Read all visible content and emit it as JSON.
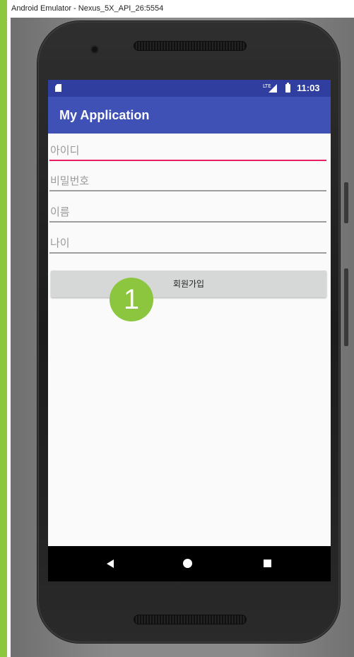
{
  "window": {
    "title": "Android Emulator - Nexus_5X_API_26:5554"
  },
  "status_bar": {
    "time": "11:03",
    "signal_label": "LTE"
  },
  "app_bar": {
    "title": "My Application"
  },
  "form": {
    "fields": [
      {
        "placeholder": "아이디",
        "focused": true
      },
      {
        "placeholder": "비밀번호",
        "focused": false
      },
      {
        "placeholder": "이름",
        "focused": false
      },
      {
        "placeholder": "나이",
        "focused": false
      }
    ],
    "signup_label": "회원가입"
  },
  "annotation": {
    "badge_number": "1"
  },
  "colors": {
    "status_bar": "#303f9f",
    "app_bar": "#3f51b5",
    "focus_underline": "#e91e63",
    "badge": "#8cc63f",
    "side_bar": "#8dc63f"
  },
  "nav_icons": [
    "back-icon",
    "home-icon",
    "recents-icon"
  ]
}
